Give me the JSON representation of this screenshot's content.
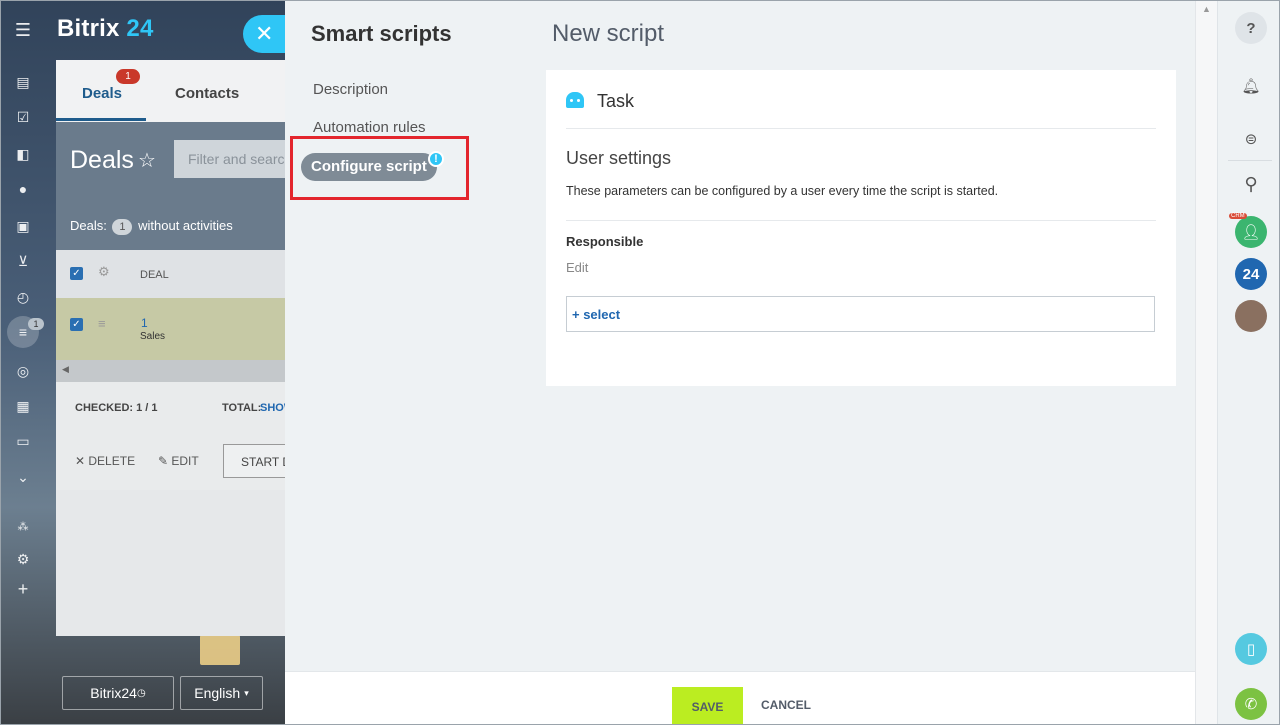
{
  "app": {
    "logo_main": "Bitrix",
    "logo_accent": " 24"
  },
  "crm": {
    "tabs": [
      {
        "label": "Deals",
        "badge": "1"
      },
      {
        "label": "Contacts"
      }
    ],
    "page_title": "Deals",
    "filter_placeholder": "Filter and search",
    "deals_info": {
      "prefix": "Deals:",
      "count": "1",
      "suffix": "without activities"
    },
    "table": {
      "column": "DEAL",
      "row": {
        "title": "1",
        "stage": "Sales"
      }
    },
    "footer": {
      "checked": "CHECKED: 1 / 1",
      "total_label": "TOTAL:",
      "total_value": "SHOW"
    },
    "actions": {
      "delete": "DELETE",
      "edit": "EDIT",
      "start": "START D"
    },
    "rail_badge": "1"
  },
  "bottom": {
    "bitrix24": "Bitrix24",
    "language": "English"
  },
  "panel": {
    "heading": "Smart scripts",
    "nav": [
      {
        "label": "Description"
      },
      {
        "label": "Automation rules"
      },
      {
        "label": "Configure script"
      }
    ],
    "title": "New script",
    "card": {
      "task": "Task",
      "section": "User settings",
      "description": "These parameters can be configured by a user every time the script is started.",
      "field_label": "Responsible",
      "field_edit": "Edit",
      "select": "+ select"
    },
    "buttons": {
      "save": "SAVE",
      "cancel": "CANCEL"
    }
  },
  "right_rail": {
    "crm_label": "CRM",
    "badge_24": "24"
  },
  "colors": {
    "accent": "#2fc6f6",
    "save": "#bbed21",
    "highlight": "#e3262d",
    "active_nav": "#7f8b96"
  }
}
